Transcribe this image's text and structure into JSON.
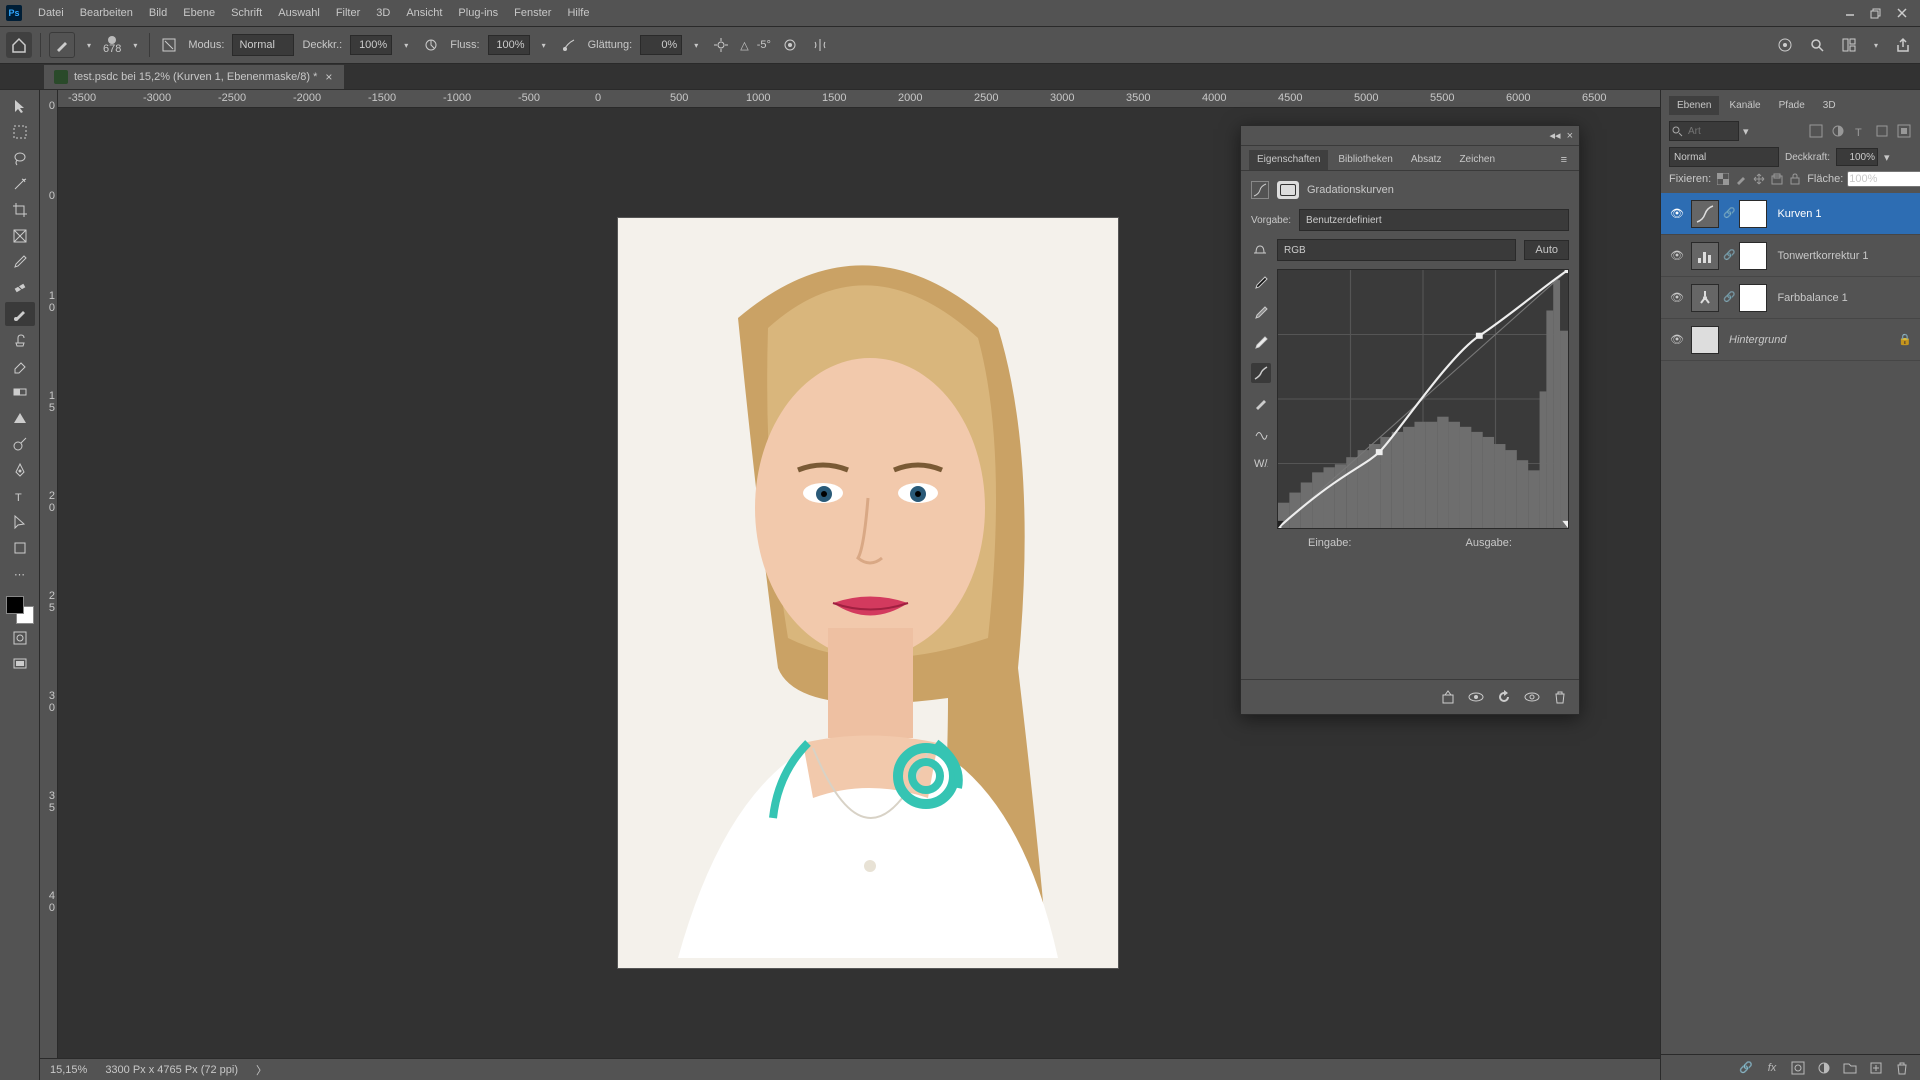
{
  "menubar": {
    "items": [
      "Datei",
      "Bearbeiten",
      "Bild",
      "Ebene",
      "Schrift",
      "Auswahl",
      "Filter",
      "3D",
      "Ansicht",
      "Plug-ins",
      "Fenster",
      "Hilfe"
    ]
  },
  "optionsbar": {
    "brush_size": "678",
    "mode_label": "Modus:",
    "mode_value": "Normal",
    "opacity_label": "Deckkr.:",
    "opacity_value": "100%",
    "flow_label": "Fluss:",
    "flow_value": "100%",
    "smoothing_label": "Glättung:",
    "smoothing_value": "0%",
    "angle_icon": "△",
    "angle_value": "-5°"
  },
  "document": {
    "tab_title": "test.psdc bei 15,2% (Kurven 1, Ebenenmaske/8) *"
  },
  "ruler_h": [
    "-3500",
    "-3000",
    "-2500",
    "-2000",
    "-1500",
    "-1000",
    "-500",
    "0",
    "500",
    "1000",
    "1500",
    "2000",
    "2500",
    "3000",
    "3500",
    "4000",
    "4500",
    "5000",
    "5500",
    "6000",
    "6500"
  ],
  "properties": {
    "tabs": [
      "Eigenschaften",
      "Bibliotheken",
      "Absatz",
      "Zeichen"
    ],
    "title": "Gradationskurven",
    "preset_label": "Vorgabe:",
    "preset_value": "Benutzerdefiniert",
    "channel_value": "RGB",
    "auto_label": "Auto",
    "input_label": "Eingabe:",
    "output_label": "Ausgabe:"
  },
  "layers_panel": {
    "tabs": [
      "Ebenen",
      "Kanäle",
      "Pfade",
      "3D"
    ],
    "search_placeholder": "Art",
    "blend_mode": "Normal",
    "opacity_label": "Deckkraft:",
    "opacity_value": "100%",
    "lock_label": "Fixieren:",
    "fill_label": "Fläche:",
    "fill_value": "100%",
    "layers": [
      {
        "name": "Kurven 1",
        "type": "curves",
        "selected": true
      },
      {
        "name": "Tonwertkorrektur 1",
        "type": "levels",
        "selected": false
      },
      {
        "name": "Farbbalance 1",
        "type": "colorbalance",
        "selected": false
      },
      {
        "name": "Hintergrund",
        "type": "background",
        "selected": false,
        "locked": true
      }
    ]
  },
  "statusbar": {
    "zoom": "15,15%",
    "dimensions": "3300 Px x 4765 Px (72 ppi)"
  },
  "chart_data": {
    "type": "line",
    "title": "Gradationskurven",
    "xlabel": "Eingabe",
    "ylabel": "Ausgabe",
    "xlim": [
      0,
      255
    ],
    "ylim": [
      0,
      255
    ],
    "series": [
      {
        "name": "RGB curve",
        "x": [
          0,
          89,
          177,
          255
        ],
        "y": [
          0,
          75,
          190,
          255
        ]
      }
    ],
    "histogram_hint": "background luminance histogram, tall spike near highlights"
  }
}
